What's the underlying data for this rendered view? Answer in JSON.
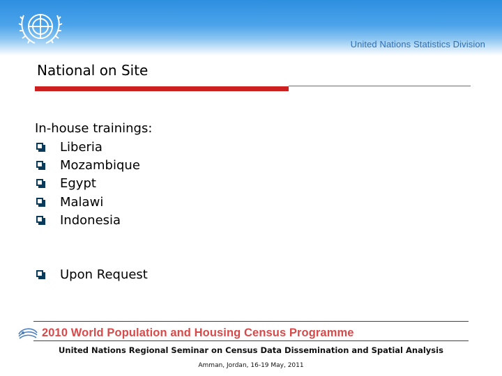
{
  "header": {
    "org_name": "United Nations Statistics Division",
    "emblem_icon": "un-emblem-icon"
  },
  "slide": {
    "title": "National on Site",
    "intro": "In-house trainings:",
    "bullets": [
      "Liberia",
      "Mozambique",
      "Egypt",
      "Malawi",
      "Indonesia"
    ],
    "extra_bullet": "Upon Request",
    "bullet_icon": "square-bullet-icon"
  },
  "footer": {
    "programme": "2010 World Population and Housing Census Programme",
    "seminar": "United Nations Regional Seminar on Census Data Dissemination and Spatial Analysis",
    "location": "Amman, Jordan, 16-19 May, 2011",
    "logo_icon": "census-programme-logo-icon"
  },
  "colors": {
    "accent_red": "#cc1f1f",
    "header_blue": "#2e8fe0",
    "org_text_blue": "#2f6fb8",
    "bullet_navy": "#0a3a5a",
    "banner_red": "#d84a4a"
  }
}
